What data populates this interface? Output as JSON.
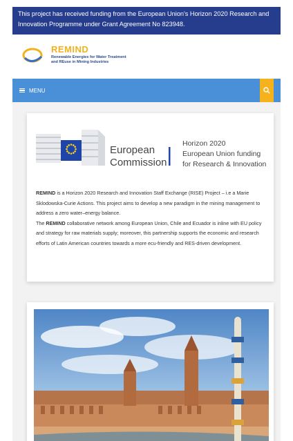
{
  "banner": {
    "text": "This project has received funding from the European Union's Horizon 2020 Research and Innovation Programme under Grant Agreement No 823948."
  },
  "logo": {
    "name": "REMIND",
    "tagline_line1": "Renewable Energies for Water Treatment",
    "tagline_line2": "and REuse in Mining Industries"
  },
  "nav": {
    "menu_label": "MENU"
  },
  "ec": {
    "line1": "European",
    "line2": "Commission",
    "h1": "Horizon 2020",
    "h2": "European Union funding",
    "h3": "for Research & Innovation"
  },
  "intro": {
    "brand1": "REMIND",
    "text1": " is a Horizon 2020 Research and Innovation Staff Exchange (RISE) Project – i.e a Marie Sklodowska-Curie Actions. This project aims to develop a new paradigm in the mining management to address a zero water–energy balance.",
    "the": "The ",
    "brand2": "REMIND",
    "text2": " collaborative network among European Union, Chile and Ecuador is inline with EU policy and strategy for raw materials supply; moreover, this partnership supports the economic and research efforts of Latin American countries towards a more ecu-friendly and RES-driven development."
  },
  "colors": {
    "banner": "#263d8e",
    "menubar": "#4a90d9",
    "search": "#f5b21c",
    "brand_yellow": "#f2b21e"
  },
  "icons": {
    "menu": "hamburger-icon",
    "search": "search-icon"
  }
}
